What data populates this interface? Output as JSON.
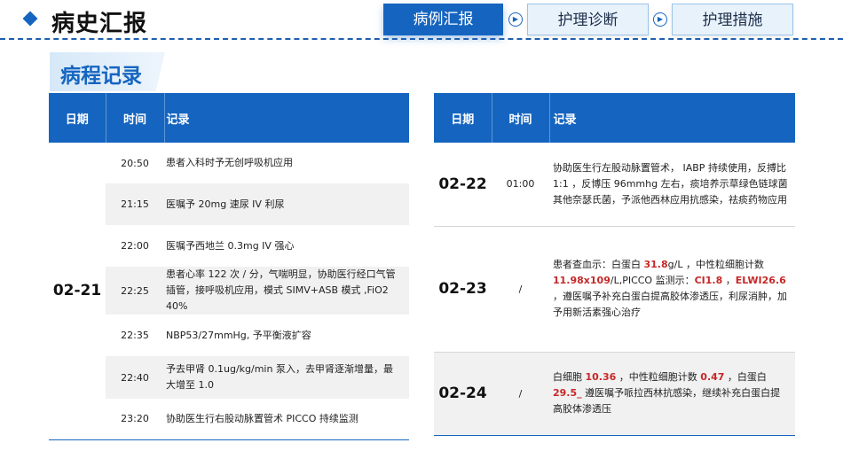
{
  "header": {
    "title": "病史汇报",
    "tabs": [
      {
        "label": "病例汇报",
        "active": true
      },
      {
        "label": "护理诊断",
        "active": false
      },
      {
        "label": "护理措施",
        "active": false
      }
    ]
  },
  "section": {
    "title": "病程记录"
  },
  "table_columns": {
    "date": "日期",
    "time": "时间",
    "record": "记录"
  },
  "left_table": {
    "date": "02-21",
    "rows": [
      {
        "time": "20:50",
        "record": "患者入科时予无创呼吸机应用"
      },
      {
        "time": "21:15",
        "record": "医嘱予 20mg 速尿  IV 利尿"
      },
      {
        "time": "22:00",
        "record": "医嘱予西地兰 0.3mg IV 强心"
      },
      {
        "time": "22:25",
        "record": "患者心率 122 次 / 分，气喘明显，协助医行经口气管插管，接呼吸机应用，模式 SIMV+ASB 模式 ,FiO2 40%"
      },
      {
        "time": "22:35",
        "record": "NBP53/27mmHg, 予平衡液扩容"
      },
      {
        "time": "22:40",
        "record": "予去甲肾 0.1ug/kg/min 泵入，去甲肾逐渐增量，最大增至 1.0"
      },
      {
        "time": "23:20",
        "record": "协助医生行右股动脉置管术 PICCO 持续监测"
      }
    ]
  },
  "right_table": {
    "rows": [
      {
        "date": "02-22",
        "time": "01:00",
        "record": "协助医生行左股动脉置管术， IABP 持续使用，反搏比1:1 ，反博压 96mmhg 左右，痰培养示草绿色链球菌其他奈瑟氏菌，予派他西林应用抗感染，祛痰药物应用"
      },
      {
        "date": "02-23",
        "time": "/",
        "record": {
          "p1": "患者查血示：白蛋白 ",
          "v1": "31.8",
          "p2": "g/L ，中性粒细胞计数 ",
          "v2": "11.98x109",
          "p3": "/L,PICCO 监测示：",
          "v3": "CI1.8",
          "p4": " ，",
          "v4": "ELWI26.6",
          "p5": " ，遵医嘱予补充白蛋白提高胶体渗透压，利尿消肿，加予用新活素强心治疗"
        }
      },
      {
        "date": "02-24",
        "time": "/",
        "record": {
          "p1": "白细胞 ",
          "v1": "10.36",
          "p2": " ，中性粒细胞计数 ",
          "v2": "0.47",
          "p3": " ，白蛋白 ",
          "v3": "29.5_",
          "p4": " 遵医嘱予哌拉西林抗感染，继续补充白蛋白提高胶体渗透压"
        }
      }
    ]
  },
  "colors": {
    "accent": "#1565c0",
    "highlight": "#c62828",
    "row_alt": "#f1f1f1"
  }
}
